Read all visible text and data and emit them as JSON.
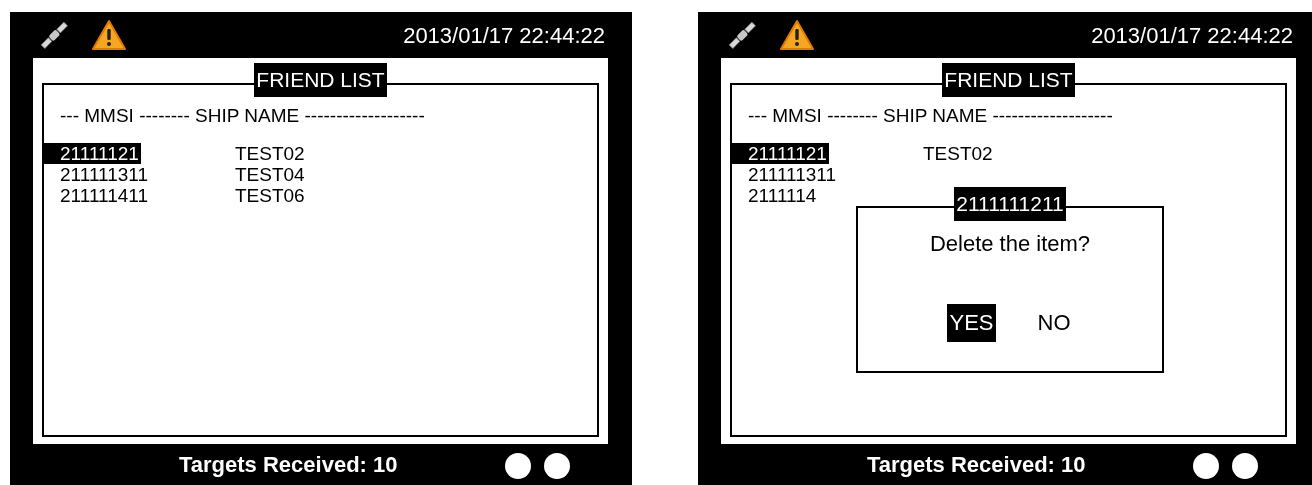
{
  "screens": [
    {
      "datetime": "2013/01/17 22:44:22",
      "panel_title": "FRIEND LIST",
      "header": "--- MMSI -------- SHIP NAME -------------------",
      "rows": [
        {
          "mmsi": "21111121",
          "name": "TEST02",
          "selected": true
        },
        {
          "mmsi": "211111311",
          "name": "TEST04",
          "selected": false
        },
        {
          "mmsi": "211111411",
          "name": "TEST06",
          "selected": false
        }
      ],
      "footer": "Targets Received: 10"
    },
    {
      "datetime": "2013/01/17 22:44:22",
      "panel_title": "FRIEND LIST",
      "header": "--- MMSI -------- SHIP NAME -------------------",
      "rows": [
        {
          "mmsi": "21111121",
          "name": "TEST02",
          "selected": true
        },
        {
          "mmsi": "211111311",
          "selected": false
        },
        {
          "mmsi": "2111114",
          "selected": false
        }
      ],
      "dialog": {
        "title": "2111111211",
        "message": "Delete the item?",
        "buttons": [
          {
            "label": "YES",
            "selected": true
          },
          {
            "label": "NO",
            "selected": false
          }
        ]
      },
      "footer": "Targets Received: 10"
    }
  ]
}
